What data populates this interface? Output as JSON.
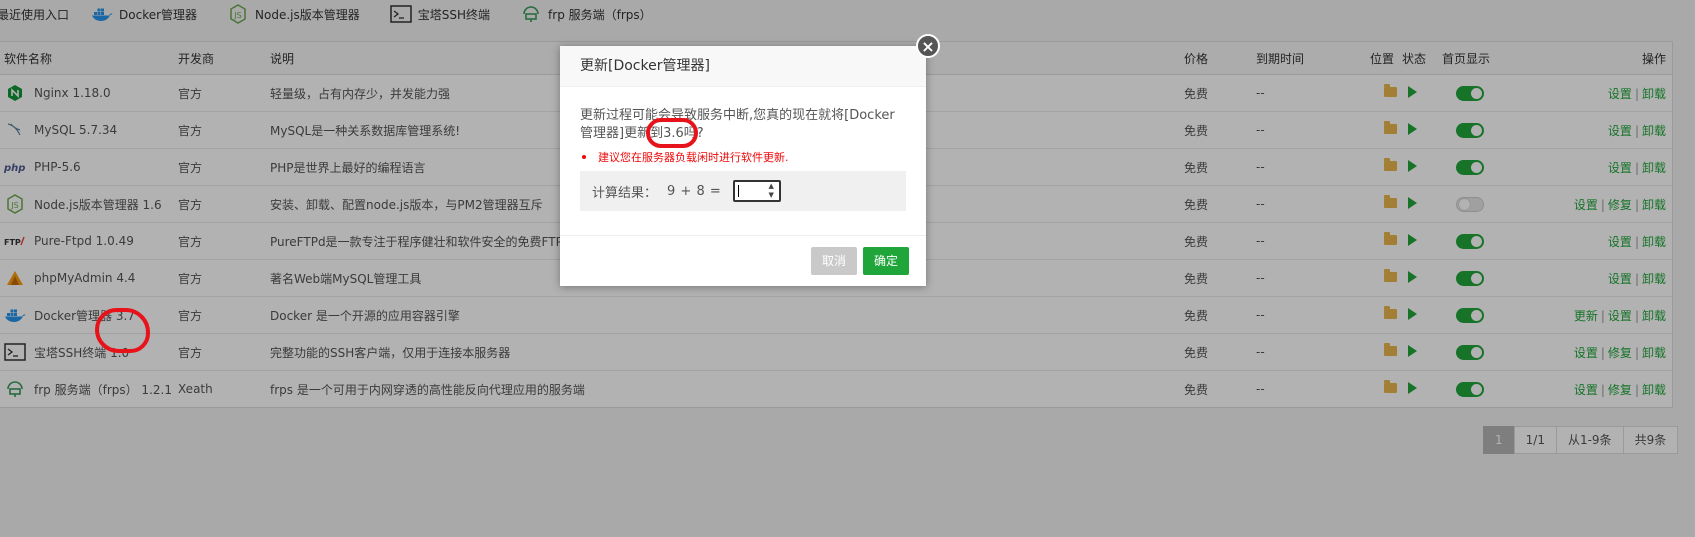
{
  "recent": {
    "label": "最近使用入口",
    "items": [
      {
        "label": "Docker管理器",
        "icon": "docker-icon"
      },
      {
        "label": "Node.js版本管理器",
        "icon": "nodejs-icon"
      },
      {
        "label": "宝塔SSH终端",
        "icon": "terminal-icon"
      },
      {
        "label": "frp 服务端（frps）",
        "icon": "frp-icon"
      }
    ]
  },
  "table": {
    "headers": {
      "name": "软件名称",
      "developer": "开发商",
      "desc": "说明",
      "price": "价格",
      "expire": "到期时间",
      "location": "位置",
      "status": "状态",
      "home": "首页显示",
      "ops": "操作"
    },
    "rows": [
      {
        "name": "Nginx 1.18.0",
        "icon": "nginx-icon",
        "developer": "官方",
        "desc": "轻量级，占有内存少，并发能力强",
        "price": "免费",
        "expire": "--",
        "home_on": true,
        "actions": [
          "设置",
          "卸载"
        ]
      },
      {
        "name": "MySQL 5.7.34",
        "icon": "mysql-icon",
        "developer": "官方",
        "desc": "MySQL是一种关系数据库管理系统!",
        "price": "免费",
        "expire": "--",
        "home_on": true,
        "actions": [
          "设置",
          "卸载"
        ]
      },
      {
        "name": "PHP-5.6",
        "icon": "php-icon",
        "developer": "官方",
        "desc": "PHP是世界上最好的编程语言",
        "price": "免费",
        "expire": "--",
        "home_on": true,
        "actions": [
          "设置",
          "卸载"
        ]
      },
      {
        "name": "Node.js版本管理器 1.6",
        "icon": "nodejs-icon",
        "developer": "官方",
        "desc": "安装、卸载、配置node.js版本，与PM2管理器互斥",
        "price": "免费",
        "expire": "--",
        "home_on": false,
        "actions": [
          "设置",
          "修复",
          "卸载"
        ]
      },
      {
        "name": "Pure-Ftpd 1.0.49",
        "icon": "ftp-icon",
        "developer": "官方",
        "desc": "PureFTPd是一款专注于程序健壮和软件安全的免费FTP",
        "price": "免费",
        "expire": "--",
        "home_on": true,
        "actions": [
          "设置",
          "卸载"
        ]
      },
      {
        "name": "phpMyAdmin 4.4",
        "icon": "phpmyadmin-icon",
        "developer": "官方",
        "desc": "著名Web端MySQL管理工具",
        "price": "免费",
        "expire": "--",
        "home_on": true,
        "actions": [
          "设置",
          "卸载"
        ]
      },
      {
        "name": "Docker管理器 3.7",
        "icon": "docker-icon",
        "developer": "官方",
        "desc": "Docker 是一个开源的应用容器引擎",
        "price": "免费",
        "expire": "--",
        "home_on": true,
        "actions": [
          "更新",
          "设置",
          "卸载"
        ]
      },
      {
        "name": "宝塔SSH终端 1.0",
        "icon": "terminal-icon",
        "developer": "官方",
        "desc": "完整功能的SSH客户端，仅用于连接本服务器",
        "price": "免费",
        "expire": "--",
        "home_on": true,
        "actions": [
          "设置",
          "修复",
          "卸载"
        ]
      },
      {
        "name": "frp 服务端（frps） 1.2.1",
        "icon": "frp-icon",
        "developer": "Xeath",
        "desc": "frps 是一个可用于内网穿透的高性能反向代理应用的服务端",
        "price": "免费",
        "expire": "--",
        "home_on": true,
        "actions": [
          "设置",
          "修复",
          "卸载"
        ]
      }
    ]
  },
  "pager": {
    "current": "1",
    "pages": "1/1",
    "range": "从1-9条",
    "total": "共9条"
  },
  "dialog": {
    "title": "更新[Docker管理器]",
    "message_prefix": "更新过程可能会导致服务中断,您真的现在就将[Docker管理器]更新到",
    "version": "3.6",
    "message_suffix": "吗?",
    "warning": "建议您在服务器负载闲时进行软件更新.",
    "calc_label": "计算结果：",
    "calc_expr": "9 + 8  =",
    "calc_value": "",
    "cancel": "取消",
    "confirm": "确定",
    "close": "×"
  },
  "colors": {
    "accent": "#20a53a",
    "warning": "#ef0808",
    "annotation": "#e8131a"
  }
}
